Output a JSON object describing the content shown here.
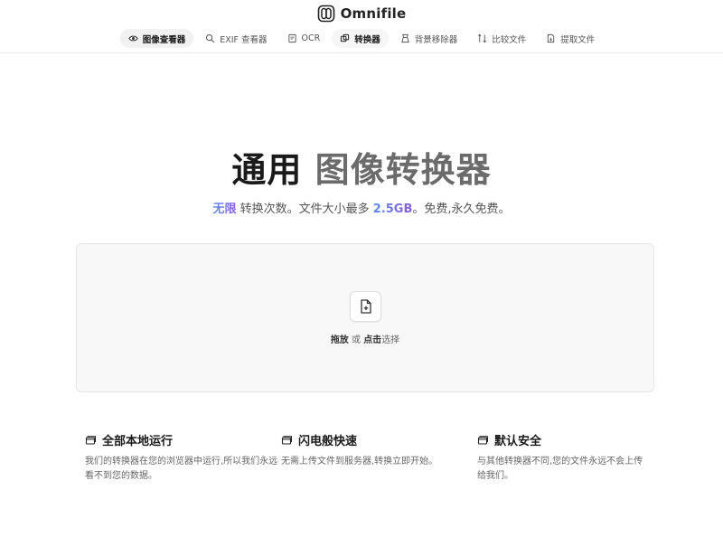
{
  "brand": {
    "name": "Omnifile",
    "logo_icon": "omnifile-logo-icon"
  },
  "nav": {
    "items": [
      {
        "label": "图像查看器",
        "icon": "eye-icon"
      },
      {
        "label": "EXIF 查看器",
        "icon": "search-icon"
      },
      {
        "label": "OCR",
        "icon": "document-text-icon"
      },
      {
        "label": "转换器",
        "icon": "copy-convert-icon"
      },
      {
        "label": "背景移除器",
        "icon": "brush-icon"
      },
      {
        "label": "比较文件",
        "icon": "compare-arrows-icon"
      },
      {
        "label": "提取文件",
        "icon": "file-extract-icon"
      }
    ]
  },
  "hero": {
    "title_strong": "通用",
    "title_muted": "图像转换器",
    "subtitle_highlight": "无限",
    "subtitle_mid": "转换次数。文件大小最多",
    "subtitle_size": "2.5GB",
    "subtitle_end": "。免费,永久免费。"
  },
  "dropzone": {
    "icon": "file-plus-icon",
    "drag": "拖放",
    "or": "或",
    "click": "点击",
    "select": "选择"
  },
  "features": [
    {
      "title": "全部本地运行",
      "desc": "我们的转换器在您的浏览器中运行,所以我们永远看不到您的数据。",
      "icon": "window-icon"
    },
    {
      "title": "闪电般快速",
      "desc": "无需上传文件到服务器,转换立即开始。",
      "icon": "window-icon"
    },
    {
      "title": "默认安全",
      "desc": "与其他转换器不同,您的文件永远不会上传给我们。",
      "icon": "window-icon"
    }
  ],
  "colors": {
    "accent_from": "#5b8def",
    "accent_to": "#8a5bd8"
  }
}
